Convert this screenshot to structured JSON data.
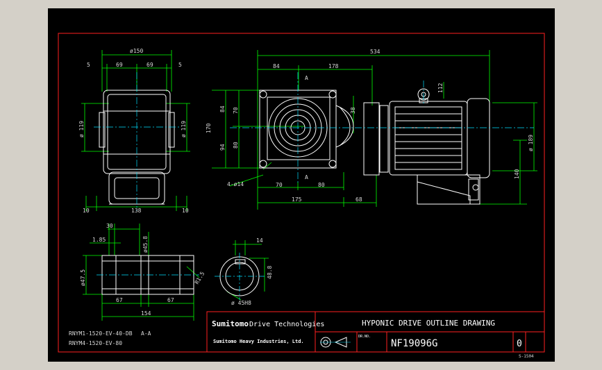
{
  "colors": {
    "frame": "#ff2020",
    "dim": "#00ff00",
    "center": "#00e0ff",
    "outline": "#ffffff",
    "background": "#000000",
    "canvas": "#d4d0c8"
  },
  "top_view": {
    "diam_150": "ø150",
    "w5_left": "5",
    "w69_left": "69",
    "w69_right": "69",
    "w5_right": "5",
    "diam_119_left": "ø 119",
    "diam_119_right": "ø 119",
    "w10_left": "10",
    "w138": "138",
    "w10_right": "10"
  },
  "front_view": {
    "len_534": "534",
    "len_84": "84",
    "len_178": "178",
    "section_a_top": "A",
    "section_a_bottom": "A",
    "h_84": "84",
    "h_70_up": "70",
    "h_170": "170",
    "h_94": "94",
    "h_80_down": "80",
    "w_38": "38",
    "hole": "4-ø14",
    "w_70": "70",
    "w_80": "80",
    "len_175": "175",
    "len_68": "68",
    "motor_112": "112",
    "motor_diam_189": "ø 189",
    "motor_140": "140"
  },
  "shaft_view": {
    "d30": "30",
    "d1_85": "1.85",
    "diam_45_8": "ø45.8",
    "diam_47_5": "ø47.5",
    "r_1_5": "R1.5",
    "l_67_left": "67",
    "l_67_right": "67",
    "l_154": "154"
  },
  "section_view": {
    "w14": "14",
    "h48_8": "48.8",
    "bore": "ø 45H8"
  },
  "notes": {
    "model_1": "RNYM1-1520-EV-40-DB",
    "model_2": "RNYM4-1520-EV-80",
    "section_label": "A-A"
  },
  "title_block": {
    "company_prefix": "Sumitomo",
    "company_suffix": " Drive Technologies",
    "subsidiary": "Sumitomo Heavy Industries, Ltd.",
    "title": "HYPONIC DRIVE OUTLINE DRAWING",
    "small_label": "DR.NO.",
    "drawing_number": "NF19096G",
    "revision": "0"
  },
  "sheet_code": "S-1504"
}
